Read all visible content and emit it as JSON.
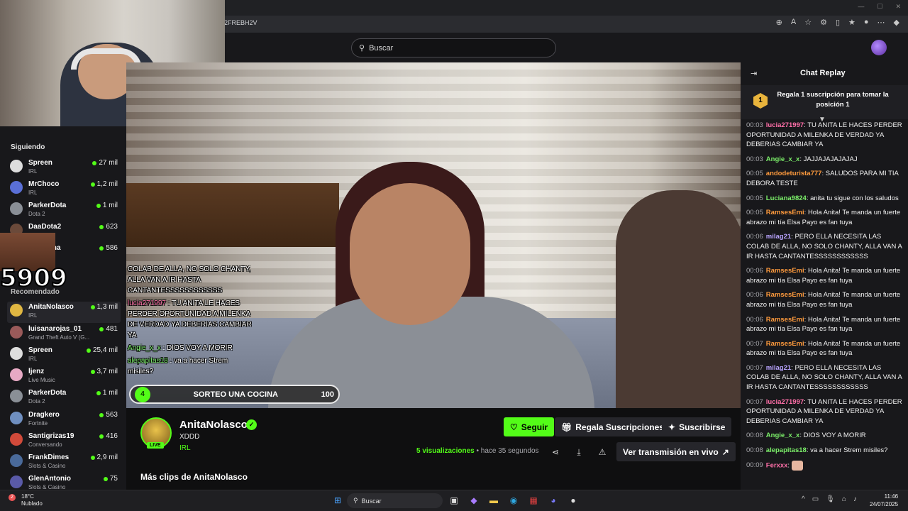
{
  "browser": {
    "url_fragment": "2FREBH2V"
  },
  "header": {
    "search_placeholder": "Buscar"
  },
  "overlay": {
    "counter": "5909"
  },
  "sidebar": {
    "following_title": "Siguiendo",
    "recommended_title": "Recomendado",
    "following": [
      {
        "name": "Spreen",
        "category": "IRL",
        "viewers": "27 mil"
      },
      {
        "name": "MrChoco",
        "category": "IRL",
        "viewers": "1,2 mil"
      },
      {
        "name": "ParkerDota",
        "category": "Dota 2",
        "viewers": "1 mil"
      },
      {
        "name": "DaaDota2",
        "category": "",
        "viewers": "623"
      },
      {
        "name": "...cha",
        "category": "",
        "viewers": "586"
      }
    ],
    "recommended": [
      {
        "name": "AnitaNolasco",
        "category": "IRL",
        "viewers": "1,3 mil"
      },
      {
        "name": "luisanarojas_01",
        "category": "Grand Theft Auto V (G...",
        "viewers": "481"
      },
      {
        "name": "Spreen",
        "category": "IRL",
        "viewers": "25,4 mil"
      },
      {
        "name": "ljenz",
        "category": "Live Music",
        "viewers": "3,7 mil"
      },
      {
        "name": "ParkerDota",
        "category": "Dota 2",
        "viewers": "1 mil"
      },
      {
        "name": "Dragkero",
        "category": "Fortnite",
        "viewers": "563"
      },
      {
        "name": "Santigrizas19",
        "category": "Conversando",
        "viewers": "416"
      },
      {
        "name": "FrankDimes",
        "category": "Slots & Casino",
        "viewers": "2,9 mil"
      },
      {
        "name": "GlenAntonio",
        "category": "Slots & Casino",
        "viewers": "75"
      }
    ]
  },
  "video_overlay": {
    "chat": [
      {
        "user": "",
        "text": "COLAB DE ALLA, NO SOLO CHANTY, ALLA VAN A IR HASTA CANTANTESSSSSSSSSSSS"
      },
      {
        "user": "lucia271997",
        "text": "TU ANITA LE HACES PERDER OPORTUNIDAD A MILENKA DE VERDAD YA DEBERIAS CAMBIAR YA"
      },
      {
        "user": "Angie_x_x",
        "text": "DIOS VOY A MORIR"
      },
      {
        "user": "alepapitas18",
        "text": "va a hacer Strem misiles?"
      }
    ],
    "raffle": {
      "number": "4",
      "title": "SORTEO UNA COCINA",
      "count": "100"
    }
  },
  "stream": {
    "streamer": "AnitaNolasco",
    "live_label": "LIVE",
    "clip_title": "XDDD",
    "category": "IRL",
    "follow_label": "Seguir",
    "gift_label": "Regala Suscripciones",
    "subscribe_label": "Suscribirse",
    "views_count": "5 visualizaciones",
    "time_ago": "• hace 35 segundos",
    "watch_live_label": "Ver transmisión en vivo",
    "more_clips": "Más clips de AnitaNolasco"
  },
  "chat": {
    "title": "Chat Replay",
    "pinned": "Regala 1 suscripción para tomar la posición 1",
    "pinned_rank": "1",
    "messages": [
      {
        "ts": "00:03",
        "user": "lucia271997",
        "color": "#ff6fa8",
        "text": "TU ANITA LE HACES PERDER OPORTUNIDAD A MILENKA DE VERDAD YA DEBERIAS CAMBIAR YA"
      },
      {
        "ts": "00:03",
        "user": "Angie_x_x",
        "color": "#7cf06a",
        "text": "JAJJAJAJAJAJAJ"
      },
      {
        "ts": "00:05",
        "user": "andodeturista777",
        "color": "#ff9b3d",
        "text": "SALUDOS PARA MI TIA DEBORA TESTE"
      },
      {
        "ts": "00:05",
        "user": "Luciana9824",
        "color": "#7cf06a",
        "text": "anita tu sigue con los saludos"
      },
      {
        "ts": "00:05",
        "user": "RamsesEmi",
        "color": "#ff9b3d",
        "text": "Hola Anita! Te manda un fuerte abrazo mi tía Elsa Payo es fan tuya"
      },
      {
        "ts": "00:06",
        "user": "milag21",
        "color": "#b9a4ff",
        "text": "PERO ELLA NECESITA LAS COLAB DE ALLA, NO SOLO CHANTY, ALLA VAN A IR HASTA CANTANTESSSSSSSSSSSS"
      },
      {
        "ts": "00:06",
        "user": "RamsesEmi",
        "color": "#ff9b3d",
        "text": "Hola Anita! Te manda un fuerte abrazo mi tía Elsa Payo es fan tuya"
      },
      {
        "ts": "00:06",
        "user": "RamsesEmi",
        "color": "#ff9b3d",
        "text": "Hola Anita! Te manda un fuerte abrazo mi tía Elsa Payo es fan tuya"
      },
      {
        "ts": "00:06",
        "user": "RamsesEmi",
        "color": "#ff9b3d",
        "text": "Hola Anita! Te manda un fuerte abrazo mi tía Elsa Payo es fan tuya"
      },
      {
        "ts": "00:07",
        "user": "RamsesEmi",
        "color": "#ff9b3d",
        "text": "Hola Anita! Te manda un fuerte abrazo mi tía Elsa Payo es fan tuya"
      },
      {
        "ts": "00:07",
        "user": "milag21",
        "color": "#b9a4ff",
        "text": "PERO ELLA NECESITA LAS COLAB DE ALLA, NO SOLO CHANTY, ALLA VAN A IR HASTA CANTANTESSSSSSSSSSSS"
      },
      {
        "ts": "00:07",
        "user": "lucia271997",
        "color": "#ff6fa8",
        "text": "TU ANITA LE HACES PERDER OPORTUNIDAD A MILENKA DE VERDAD YA DEBERIAS CAMBIAR YA"
      },
      {
        "ts": "00:08",
        "user": "Angie_x_x",
        "color": "#7cf06a",
        "text": "DIOS VOY A MORIR"
      },
      {
        "ts": "00:08",
        "user": "alepapitas18",
        "color": "#7cf06a",
        "text": "va a hacer Strem misiles?"
      },
      {
        "ts": "00:09",
        "user": "Ferxxx",
        "color": "#ff6fa8",
        "text": ""
      }
    ]
  },
  "taskbar": {
    "temperature": "18°C",
    "weather": "Nublado",
    "search_label": "Buscar",
    "time": "11:46",
    "date": "24/07/2025"
  }
}
